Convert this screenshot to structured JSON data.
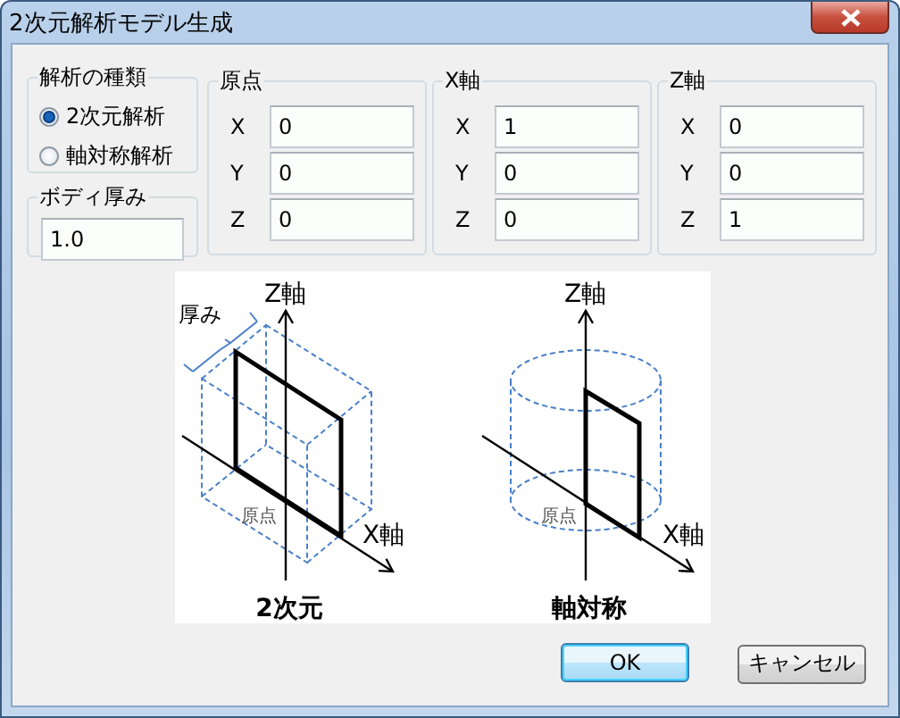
{
  "window": {
    "title": "2次元解析モデル生成"
  },
  "analysis_type": {
    "label": "解析の種類",
    "options": [
      {
        "label": "2次元解析",
        "selected": true
      },
      {
        "label": "軸対称解析",
        "selected": false
      }
    ]
  },
  "body_thickness": {
    "label": "ボディ厚み",
    "value": "1.0"
  },
  "vectors": [
    {
      "label": "原点",
      "fields": [
        {
          "label": "X",
          "value": "0"
        },
        {
          "label": "Y",
          "value": "0"
        },
        {
          "label": "Z",
          "value": "0"
        }
      ]
    },
    {
      "label": "X軸",
      "fields": [
        {
          "label": "X",
          "value": "1"
        },
        {
          "label": "Y",
          "value": "0"
        },
        {
          "label": "Z",
          "value": "0"
        }
      ]
    },
    {
      "label": "Z軸",
      "fields": [
        {
          "label": "X",
          "value": "0"
        },
        {
          "label": "Y",
          "value": "0"
        },
        {
          "label": "Z",
          "value": "1"
        }
      ]
    }
  ],
  "diagram": {
    "panels": [
      {
        "kind": "planar",
        "z_label": "Z軸",
        "x_label": "X軸",
        "origin_label": "原点",
        "thickness_label": "厚み",
        "caption": "2次元"
      },
      {
        "kind": "axisymmetric",
        "z_label": "Z軸",
        "x_label": "X軸",
        "origin_label": "原点",
        "caption": "軸対称"
      }
    ]
  },
  "buttons": [
    {
      "label": "OK",
      "default": true
    },
    {
      "label": "キャンセル",
      "default": false
    }
  ]
}
